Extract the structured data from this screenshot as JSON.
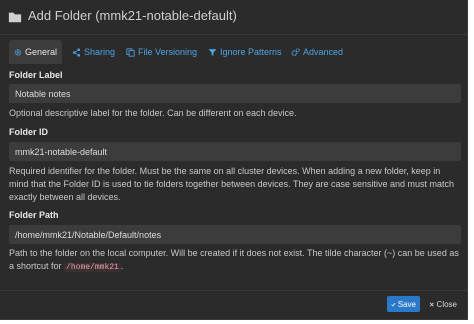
{
  "dialog": {
    "title": "Add Folder (mmk21-notable-default)"
  },
  "tabs": [
    {
      "label": "General",
      "icon": "gear-icon",
      "active": true
    },
    {
      "label": "Sharing",
      "icon": "share-icon"
    },
    {
      "label": "File Versioning",
      "icon": "copy-icon"
    },
    {
      "label": "Ignore Patterns",
      "icon": "filter-icon"
    },
    {
      "label": "Advanced",
      "icon": "cogs-icon"
    }
  ],
  "fields": {
    "folder_label": {
      "label": "Folder Label",
      "value": "Notable notes",
      "help": "Optional descriptive label for the folder. Can be different on each device."
    },
    "folder_id": {
      "label": "Folder ID",
      "value": "mmk21-notable-default",
      "help": "Required identifier for the folder. Must be the same on all cluster devices. When adding a new folder, keep in mind that the Folder ID is used to tie folders together between devices. They are case sensitive and must match exactly between all devices."
    },
    "folder_path": {
      "label": "Folder Path",
      "value": "/home/mmk21/Notable/Default/notes",
      "help_before": "Path to the folder on the local computer. Will be created if it does not exist. The tilde character (~) can be used as a shortcut for",
      "help_code": "/home/mmk21",
      "help_after": "."
    }
  },
  "footer": {
    "save_label": "Save",
    "close_label": "Close"
  },
  "colors": {
    "background": "#2b2b2b",
    "input_background": "#3c3c3c",
    "accent": "#4fa3e0",
    "primary_button": "#2a78c8"
  }
}
